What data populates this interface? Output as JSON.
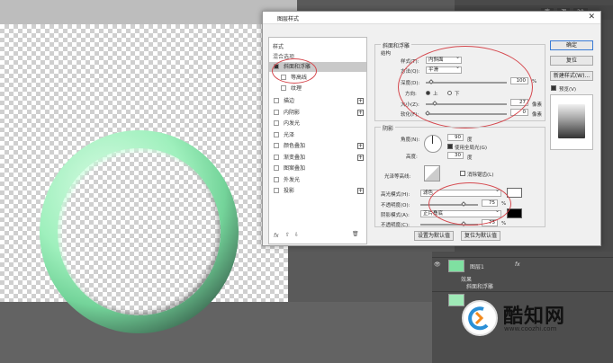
{
  "top_tabs": [
    "库",
    "调",
    "20"
  ],
  "layers": {
    "layer_name": "图层1",
    "effects_label": "效果",
    "effect_item": "斜面和浮雕"
  },
  "dialog": {
    "title": "图层样式",
    "close": "✕",
    "left_list": {
      "header": "样式",
      "blend": "混合选项",
      "items": [
        {
          "label": "斜面和浮雕",
          "checked": true,
          "plus": false
        },
        {
          "label": "等高线",
          "checked": false,
          "plus": false
        },
        {
          "label": "纹理",
          "checked": false,
          "plus": false
        },
        {
          "label": "描边",
          "checked": false,
          "plus": true
        },
        {
          "label": "内阴影",
          "checked": false,
          "plus": true
        },
        {
          "label": "内发光",
          "checked": false,
          "plus": false
        },
        {
          "label": "光泽",
          "checked": false,
          "plus": false
        },
        {
          "label": "颜色叠加",
          "checked": false,
          "plus": true
        },
        {
          "label": "渐变叠加",
          "checked": false,
          "plus": true
        },
        {
          "label": "图案叠加",
          "checked": false,
          "plus": false
        },
        {
          "label": "外发光",
          "checked": false,
          "plus": false
        },
        {
          "label": "投影",
          "checked": false,
          "plus": true
        }
      ],
      "footer_fx": "fx",
      "footer_up": "⇧",
      "footer_down": "⇩",
      "footer_trash": "🗑"
    },
    "bevel": {
      "section": "斜面和浮雕",
      "structure": "结构",
      "style_label": "样式(T):",
      "style_value": "内斜面",
      "technique_label": "方法(Q):",
      "technique_value": "平滑",
      "depth_label": "深度(D):",
      "depth_value": "100",
      "percent": "%",
      "direction_label": "方向:",
      "dir_up": "上",
      "dir_down": "下",
      "size_label": "大小(Z):",
      "size_value": "27",
      "soften_label": "软化(F):",
      "soften_value": "0",
      "px": "像素"
    },
    "shading": {
      "section": "阴影",
      "angle_label": "角度(N):",
      "angle_value": "90",
      "degree": "度",
      "global_light": "使用全局光(G)",
      "altitude_label": "高度:",
      "altitude_value": "30",
      "gloss_label": "光泽等高线:",
      "antialias": "消除锯齿(L)",
      "hl_mode_label": "高光模式(H):",
      "hl_mode_value": "滤色",
      "hl_opacity_label": "不透明度(O):",
      "hl_opacity_value": "75",
      "sh_mode_label": "阴影模式(A):",
      "sh_mode_value": "正片叠底",
      "sh_opacity_label": "不透明度(C):",
      "sh_opacity_value": "75",
      "percent": "%",
      "highlight_color": "#ffffff",
      "shadow_color": "#000000"
    },
    "buttons": {
      "make_default": "设置为默认值",
      "reset_default": "复位为默认值",
      "ok": "确定",
      "reset": "复位",
      "new_style": "新建样式(W)...",
      "preview": "预览(V)"
    }
  },
  "watermark": {
    "name": "酷知网",
    "url": "www.coozhi.com"
  }
}
